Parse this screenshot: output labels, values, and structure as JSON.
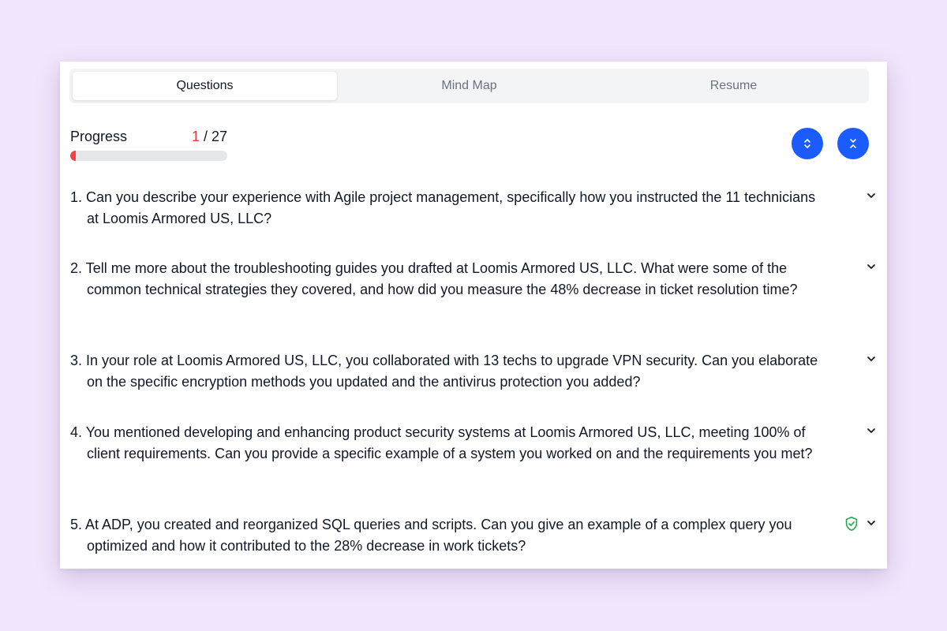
{
  "tabs": [
    {
      "label": "Questions",
      "active": true
    },
    {
      "label": "Mind Map",
      "active": false
    },
    {
      "label": "Resume",
      "active": false
    }
  ],
  "progress": {
    "label": "Progress",
    "current": "1",
    "separator": " / ",
    "total": "27",
    "fraction": 0.037
  },
  "controls": {
    "expand_icon": "chevrons-up-down-icon",
    "collapse_icon": "chevrons-collapse-icon"
  },
  "questions": [
    {
      "text": "1. Can you describe your experience with Agile project management, specifically how you instructed the 11 technicians at Loomis Armored US, LLC?",
      "verified": false
    },
    {
      "text": "2. Tell me more about the troubleshooting guides you drafted at Loomis Armored US, LLC. What were some of the common technical strategies they covered, and how did you measure the 48% decrease in ticket resolution time?",
      "verified": false
    },
    {
      "text": "3. In your role at Loomis Armored US, LLC, you collaborated with 13 techs to upgrade VPN security. Can you elaborate on the specific encryption methods you updated and the antivirus protection you added?",
      "verified": false
    },
    {
      "text": "4. You mentioned developing and enhancing product security systems at Loomis Armored US, LLC, meeting 100% of client requirements. Can you provide a specific example of a system you worked on and the requirements you met?",
      "verified": false
    },
    {
      "text": "5. At ADP, you created and reorganized SQL queries and scripts. Can you give an example of a complex query you optimized and how it contributed to the 28% decrease in work tickets?",
      "verified": true
    }
  ],
  "colors": {
    "accent_blue": "#1a5cff",
    "progress_red": "#ef4444",
    "shield_green": "#22a94f",
    "background": "#f1e5fc"
  }
}
